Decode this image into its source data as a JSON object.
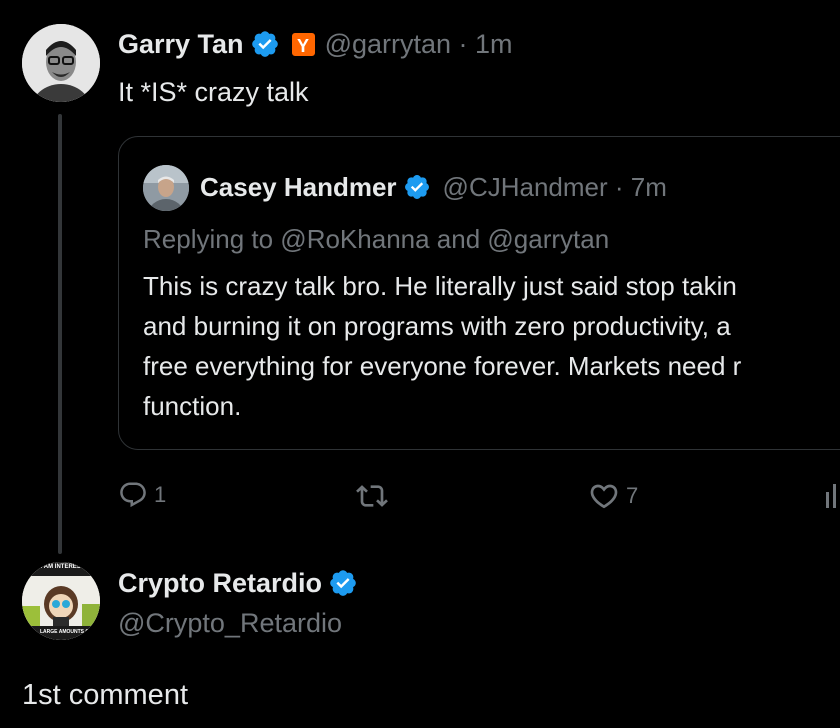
{
  "tweet": {
    "author_name": "Garry Tan",
    "handle_time": "@garrytan · 1m",
    "badge_letter": "Y",
    "text": "It *IS* crazy talk"
  },
  "quote": {
    "author_name": "Casey Handmer",
    "handle_time": "@CJHandmer · 7m",
    "replying_to": "Replying to @RoKhanna and @garrytan",
    "lines": [
      "This is crazy talk bro. He literally just said stop takin",
      "and burning it on programs with zero productivity, a",
      "free everything for everyone forever. Markets need r",
      "function."
    ]
  },
  "actions": {
    "reply_count": "1",
    "retweet_count": "",
    "like_count": "7"
  },
  "reply": {
    "author_name": "Crypto Retardio",
    "handle": "@Crypto_Retardio",
    "avatar_text_top": "ELY I AM INTERESTED",
    "avatar_text_bottom": "LARGE AMOUNTS OF",
    "text": "1st comment"
  },
  "colors": {
    "background": "#000000",
    "text": "#e7e9ea",
    "secondary": "#71767b",
    "verified": "#1d9bf0",
    "border": "#2f3336",
    "yc_orange": "#ff6600"
  },
  "icons": [
    "verified-badge-icon",
    "reply-icon",
    "retweet-icon",
    "like-icon",
    "views-icon"
  ]
}
